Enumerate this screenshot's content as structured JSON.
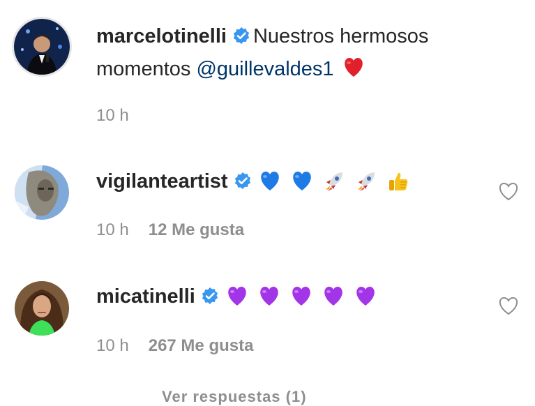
{
  "caption": {
    "username": "marcelotinelli",
    "text": "Nuestros hermosos",
    "text_line2": "momentos",
    "mention": "@guillevaldes1",
    "trailing_emoji": "red-heart-emoji",
    "time": "10 h"
  },
  "comments": [
    {
      "username": "vigilanteartist",
      "emojis": [
        "blue-heart-emoji",
        "blue-heart-emoji",
        "rocket-emoji",
        "rocket-emoji",
        "thumbs-up-emoji"
      ],
      "time": "10 h",
      "likes": "12 Me gusta"
    },
    {
      "username": "micatinelli",
      "emojis": [
        "purple-heart-emoji",
        "purple-heart-emoji",
        "purple-heart-emoji",
        "purple-heart-emoji",
        "purple-heart-emoji"
      ],
      "time": "10 h",
      "likes": "267 Me gusta"
    }
  ],
  "more_replies_label": "Ver respuestas (1)",
  "colors": {
    "text": "#262626",
    "secondary": "#8e8e8e",
    "mention": "#003569",
    "verified": "#3897f0"
  }
}
